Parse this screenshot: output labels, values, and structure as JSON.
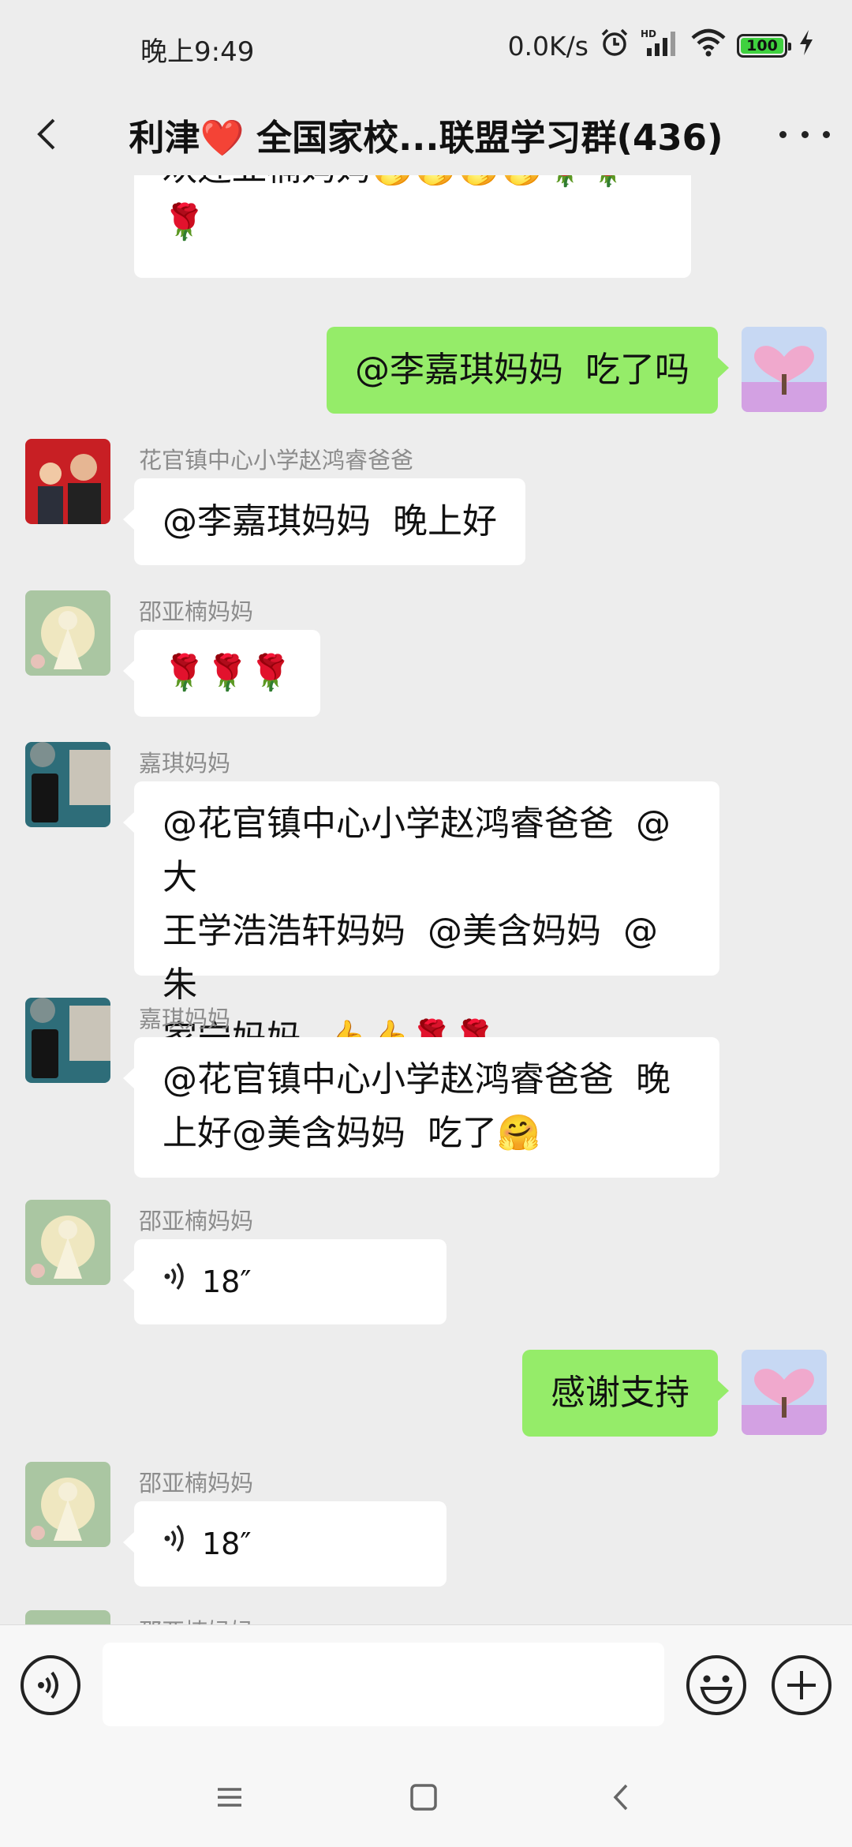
{
  "status_bar": {
    "time": "晚上9:49",
    "network_speed": "0.0K/s",
    "icons": [
      "alarm-icon",
      "hd-signal-icon",
      "wifi-icon",
      "battery-icon",
      "charging-icon"
    ],
    "battery": "100",
    "hd_label": "HD"
  },
  "header": {
    "title_prefix": "利津",
    "title_heart": "❤️",
    "title_suffix": " 全国家校...联盟学习群(436)",
    "back_icon": "chevron-left-icon",
    "more_icon": "more-dots-icon"
  },
  "messages": [
    {
      "type": "text",
      "side": "left",
      "sender": "",
      "text": "欢迎亚楠妈妈🤭🤭🤭🤭🌹🌹\n🌹",
      "avatar": "desk-phone-avatar"
    },
    {
      "type": "text",
      "side": "right",
      "sender": "",
      "text": "@李嘉琪妈妈  吃了吗",
      "avatar": "pink-tree-avatar"
    },
    {
      "type": "text",
      "side": "left",
      "sender": "花官镇中心小学赵鸿睿爸爸",
      "text": "@李嘉琪妈妈  晚上好",
      "avatar": "father-son-avatar"
    },
    {
      "type": "text",
      "side": "left",
      "sender": "邵亚楠妈妈",
      "text": "🌹🌹🌹",
      "avatar": "guanyin-avatar"
    },
    {
      "type": "text",
      "side": "left",
      "sender": "嘉琪妈妈",
      "text": "@花官镇中心小学赵鸿睿爸爸  @大\n王学浩浩轩妈妈  @美含妈妈  @朱\n家宁妈妈  👍👍🌹🌹",
      "avatar": "desk-phone-avatar"
    },
    {
      "type": "text",
      "side": "left",
      "sender": "嘉琪妈妈",
      "text": "@花官镇中心小学赵鸿睿爸爸  晚\n上好@美含妈妈  吃了🤗",
      "avatar": "desk-phone-avatar"
    },
    {
      "type": "voice",
      "side": "left",
      "sender": "邵亚楠妈妈",
      "duration": "18″",
      "avatar": "guanyin-avatar"
    },
    {
      "type": "text",
      "side": "right",
      "sender": "",
      "text": "感谢支持",
      "avatar": "pink-tree-avatar"
    },
    {
      "type": "voice",
      "side": "left",
      "sender": "邵亚楠妈妈",
      "duration": "18″",
      "avatar": "guanyin-avatar"
    },
    {
      "type": "partial",
      "side": "left",
      "sender": "邵亚楠妈妈",
      "avatar": "guanyin-avatar"
    }
  ],
  "input_bar": {
    "placeholder": "",
    "value": "",
    "voice_icon": "voice-input-icon",
    "emoji_icon": "emoji-icon",
    "plus_icon": "plus-circle-icon"
  },
  "nav_bar": {
    "icons": [
      "menu-icon",
      "home-square-icon",
      "back-triangle-icon"
    ]
  },
  "colors": {
    "background": "#ededed",
    "self_bubble": "#95ec69",
    "other_bubble": "#ffffff",
    "sender_name": "#8c8c8c",
    "heart": "#d9262c"
  }
}
